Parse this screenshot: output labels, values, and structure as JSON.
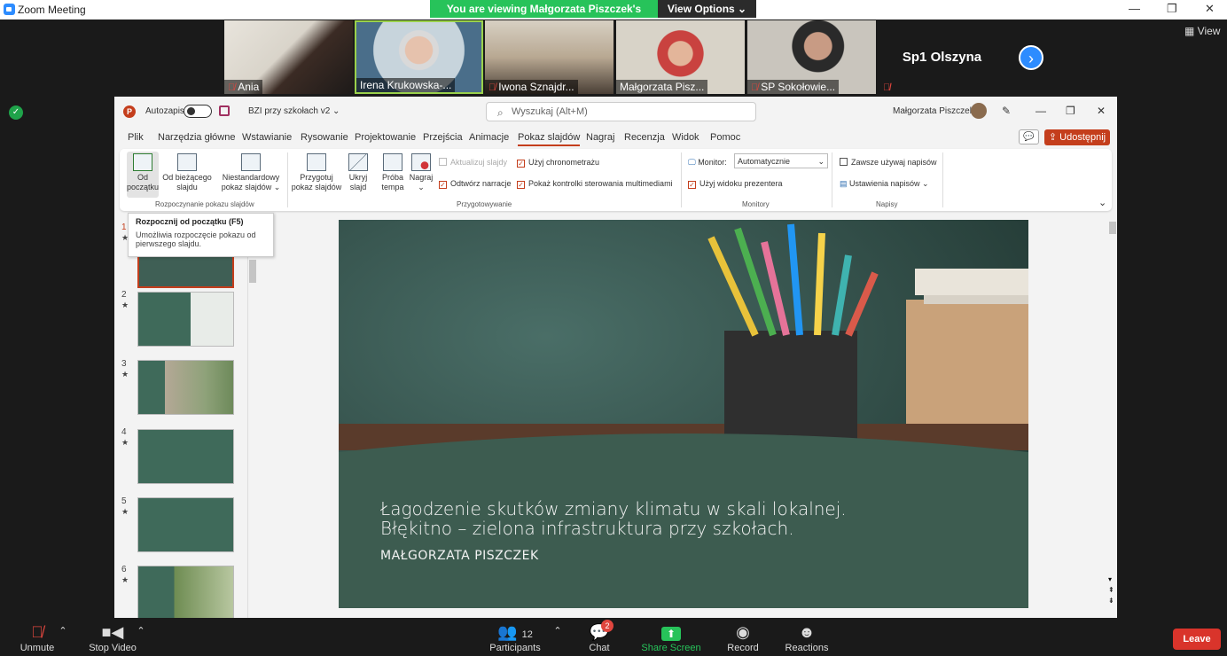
{
  "window": {
    "title": "Zoom Meeting",
    "min": "—",
    "restore": "❐",
    "close": "✕"
  },
  "banner": {
    "viewing": "You are viewing Małgorzata Piszczek's screen",
    "view_options": "View Options ⌄"
  },
  "gallery": {
    "tiles": [
      {
        "name": "Ania",
        "muted": true
      },
      {
        "name": "Irena Krukowska-...",
        "muted": false
      },
      {
        "name": "Iwona Sznajdr...",
        "muted": true
      },
      {
        "name": "Małgorzata Pisz...",
        "muted": false
      },
      {
        "name": "SP Sokołowie...",
        "muted": true
      }
    ],
    "name_only": "Sp1 Olszyna",
    "view_label": "View"
  },
  "ppt": {
    "autosave": "Autozapis",
    "docname": "BZI przy szkołach v2 ⌄",
    "search": "Wyszukaj (Alt+M)",
    "user": "Małgorzata Piszczek",
    "menu": [
      "Plik",
      "Narzędzia główne",
      "Wstawianie",
      "Rysowanie",
      "Projektowanie",
      "Przejścia",
      "Animacje",
      "Pokaz slajdów",
      "Nagraj",
      "Recenzja",
      "Widok",
      "Pomoc"
    ],
    "share": "Udostępnij",
    "ribbon": {
      "btn_from_start": [
        "Od",
        "początku"
      ],
      "btn_from_current": [
        "Od bieżącego",
        "slajdu"
      ],
      "btn_custom": [
        "Niestandardowy",
        "pokaz slajdów ⌄"
      ],
      "btn_setup": [
        "Przygotuj",
        "pokaz slajdów"
      ],
      "btn_hide": [
        "Ukryj",
        "slajd"
      ],
      "btn_rehearse": [
        "Próba",
        "tempa"
      ],
      "btn_record": [
        "Nagraj",
        "⌄"
      ],
      "chk_update": "Aktualizuj slajdy",
      "chk_timings": "Użyj chronometrażu",
      "chk_narration": "Odtwórz narracje",
      "chk_media": "Pokaż kontrolki sterowania multimediami",
      "monitor_label": "Monitor:",
      "monitor_value": "Automatycznie",
      "chk_presenter": "Użyj widoku prezentera",
      "chk_captions": "Zawsze używaj napisów",
      "captions_settings": "Ustawienia napisów ⌄",
      "grp_start": "Rozpoczynanie pokazu slajdów",
      "grp_setup": "Przygotowywanie",
      "grp_monitors": "Monitory",
      "grp_captions": "Napisy"
    },
    "tooltip": {
      "title": "Rozpocznij od początku (F5)",
      "body": "Umożliwia rozpoczęcie pokazu od pierwszego slajdu."
    },
    "thumbs": [
      "1",
      "2",
      "3",
      "4",
      "5",
      "6"
    ],
    "slide": {
      "line1": "Łagodzenie skutków zmiany klimatu w skali lokalnej.",
      "line2": "Błękitno – zielona infrastruktura przy szkołach.",
      "author": "MAŁGORZATA PISZCZEK"
    }
  },
  "toolbar": {
    "unmute": "Unmute",
    "stop_video": "Stop Video",
    "participants": "Participants",
    "participants_count": "12",
    "chat": "Chat",
    "chat_badge": "2",
    "share": "Share Screen",
    "record": "Record",
    "reactions": "Reactions",
    "leave": "Leave"
  }
}
